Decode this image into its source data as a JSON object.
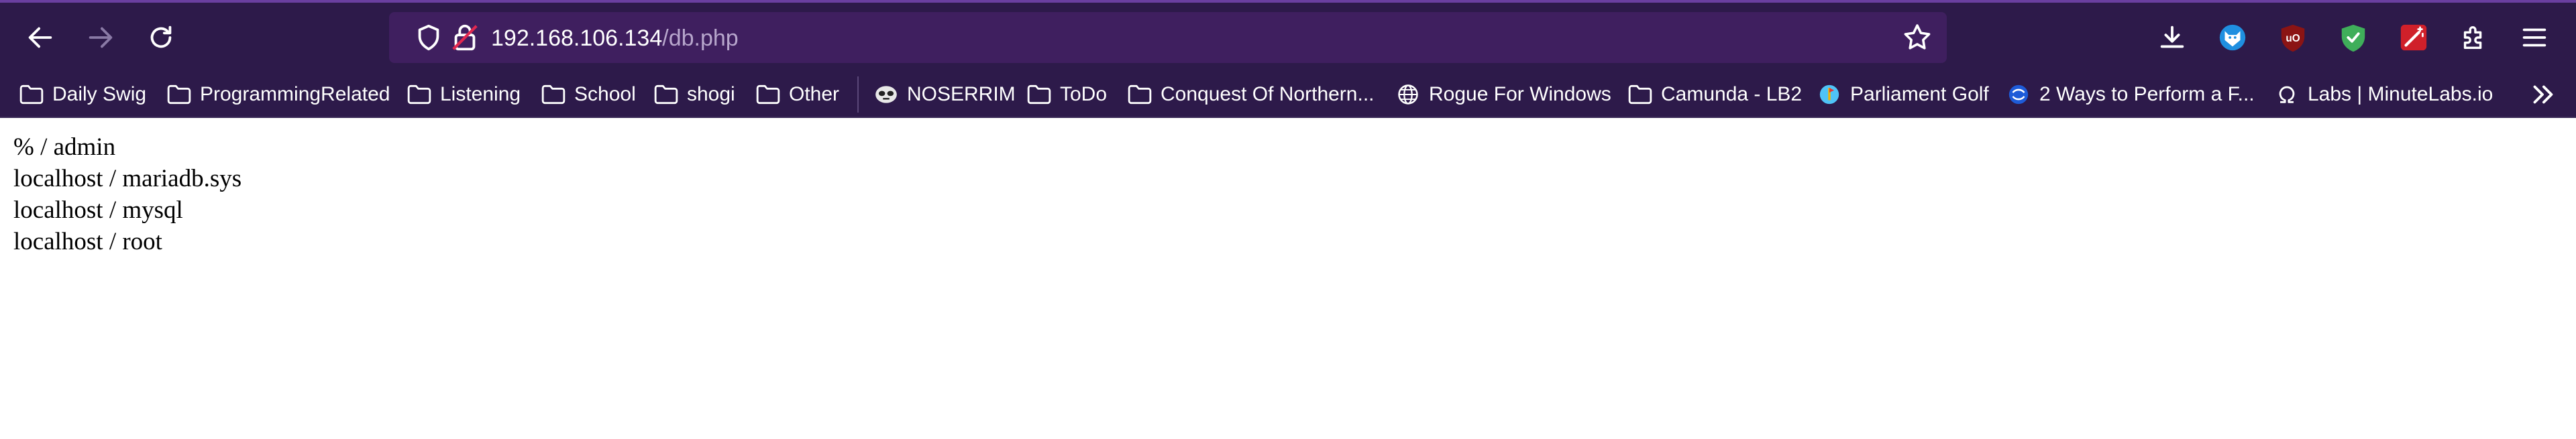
{
  "browser": {
    "url_host": "192.168.106.134",
    "url_path": "/db.php",
    "nav_icons": [
      "back-arrow-icon",
      "forward-arrow-icon",
      "reload-icon"
    ],
    "urlbar_icons": [
      "tracking-protection-shield-icon",
      "insecure-connection-lock-icon",
      "bookmark-star-icon"
    ],
    "toolbar_icons": [
      "downloads-icon",
      "fox-extension-icon",
      "ublock-origin-icon",
      "green-shield-extension-icon",
      "wand-extension-icon",
      "extensions-puzzle-icon",
      "app-menu-icon"
    ]
  },
  "bookmarks": [
    {
      "label": "Daily Swig",
      "icon": "folder-icon"
    },
    {
      "label": "ProgrammingRelated",
      "icon": "folder-icon"
    },
    {
      "label": "Listening",
      "icon": "folder-icon"
    },
    {
      "label": "School",
      "icon": "folder-icon"
    },
    {
      "label": "shogi",
      "icon": "folder-icon"
    },
    {
      "label": "Other",
      "icon": "folder-icon"
    },
    {
      "label": "NOSERRIM",
      "icon": "mask-icon"
    },
    {
      "label": "ToDo",
      "icon": "folder-icon"
    },
    {
      "label": "Conquest Of Northern...",
      "icon": "folder-icon"
    },
    {
      "label": "Rogue For Windows",
      "icon": "globe-icon"
    },
    {
      "label": "Camunda - LB2",
      "icon": "folder-icon"
    },
    {
      "label": "Parliament Golf",
      "icon": "parliament-golf-icon"
    },
    {
      "label": "2 Ways to Perform a F...",
      "icon": "blue-swirl-icon"
    },
    {
      "label": "Labs | MinuteLabs.io",
      "icon": "omega-icon"
    }
  ],
  "page": {
    "lines": [
      "% / admin",
      "localhost / mariadb.sys",
      "localhost / mysql",
      "localhost / root"
    ]
  }
}
